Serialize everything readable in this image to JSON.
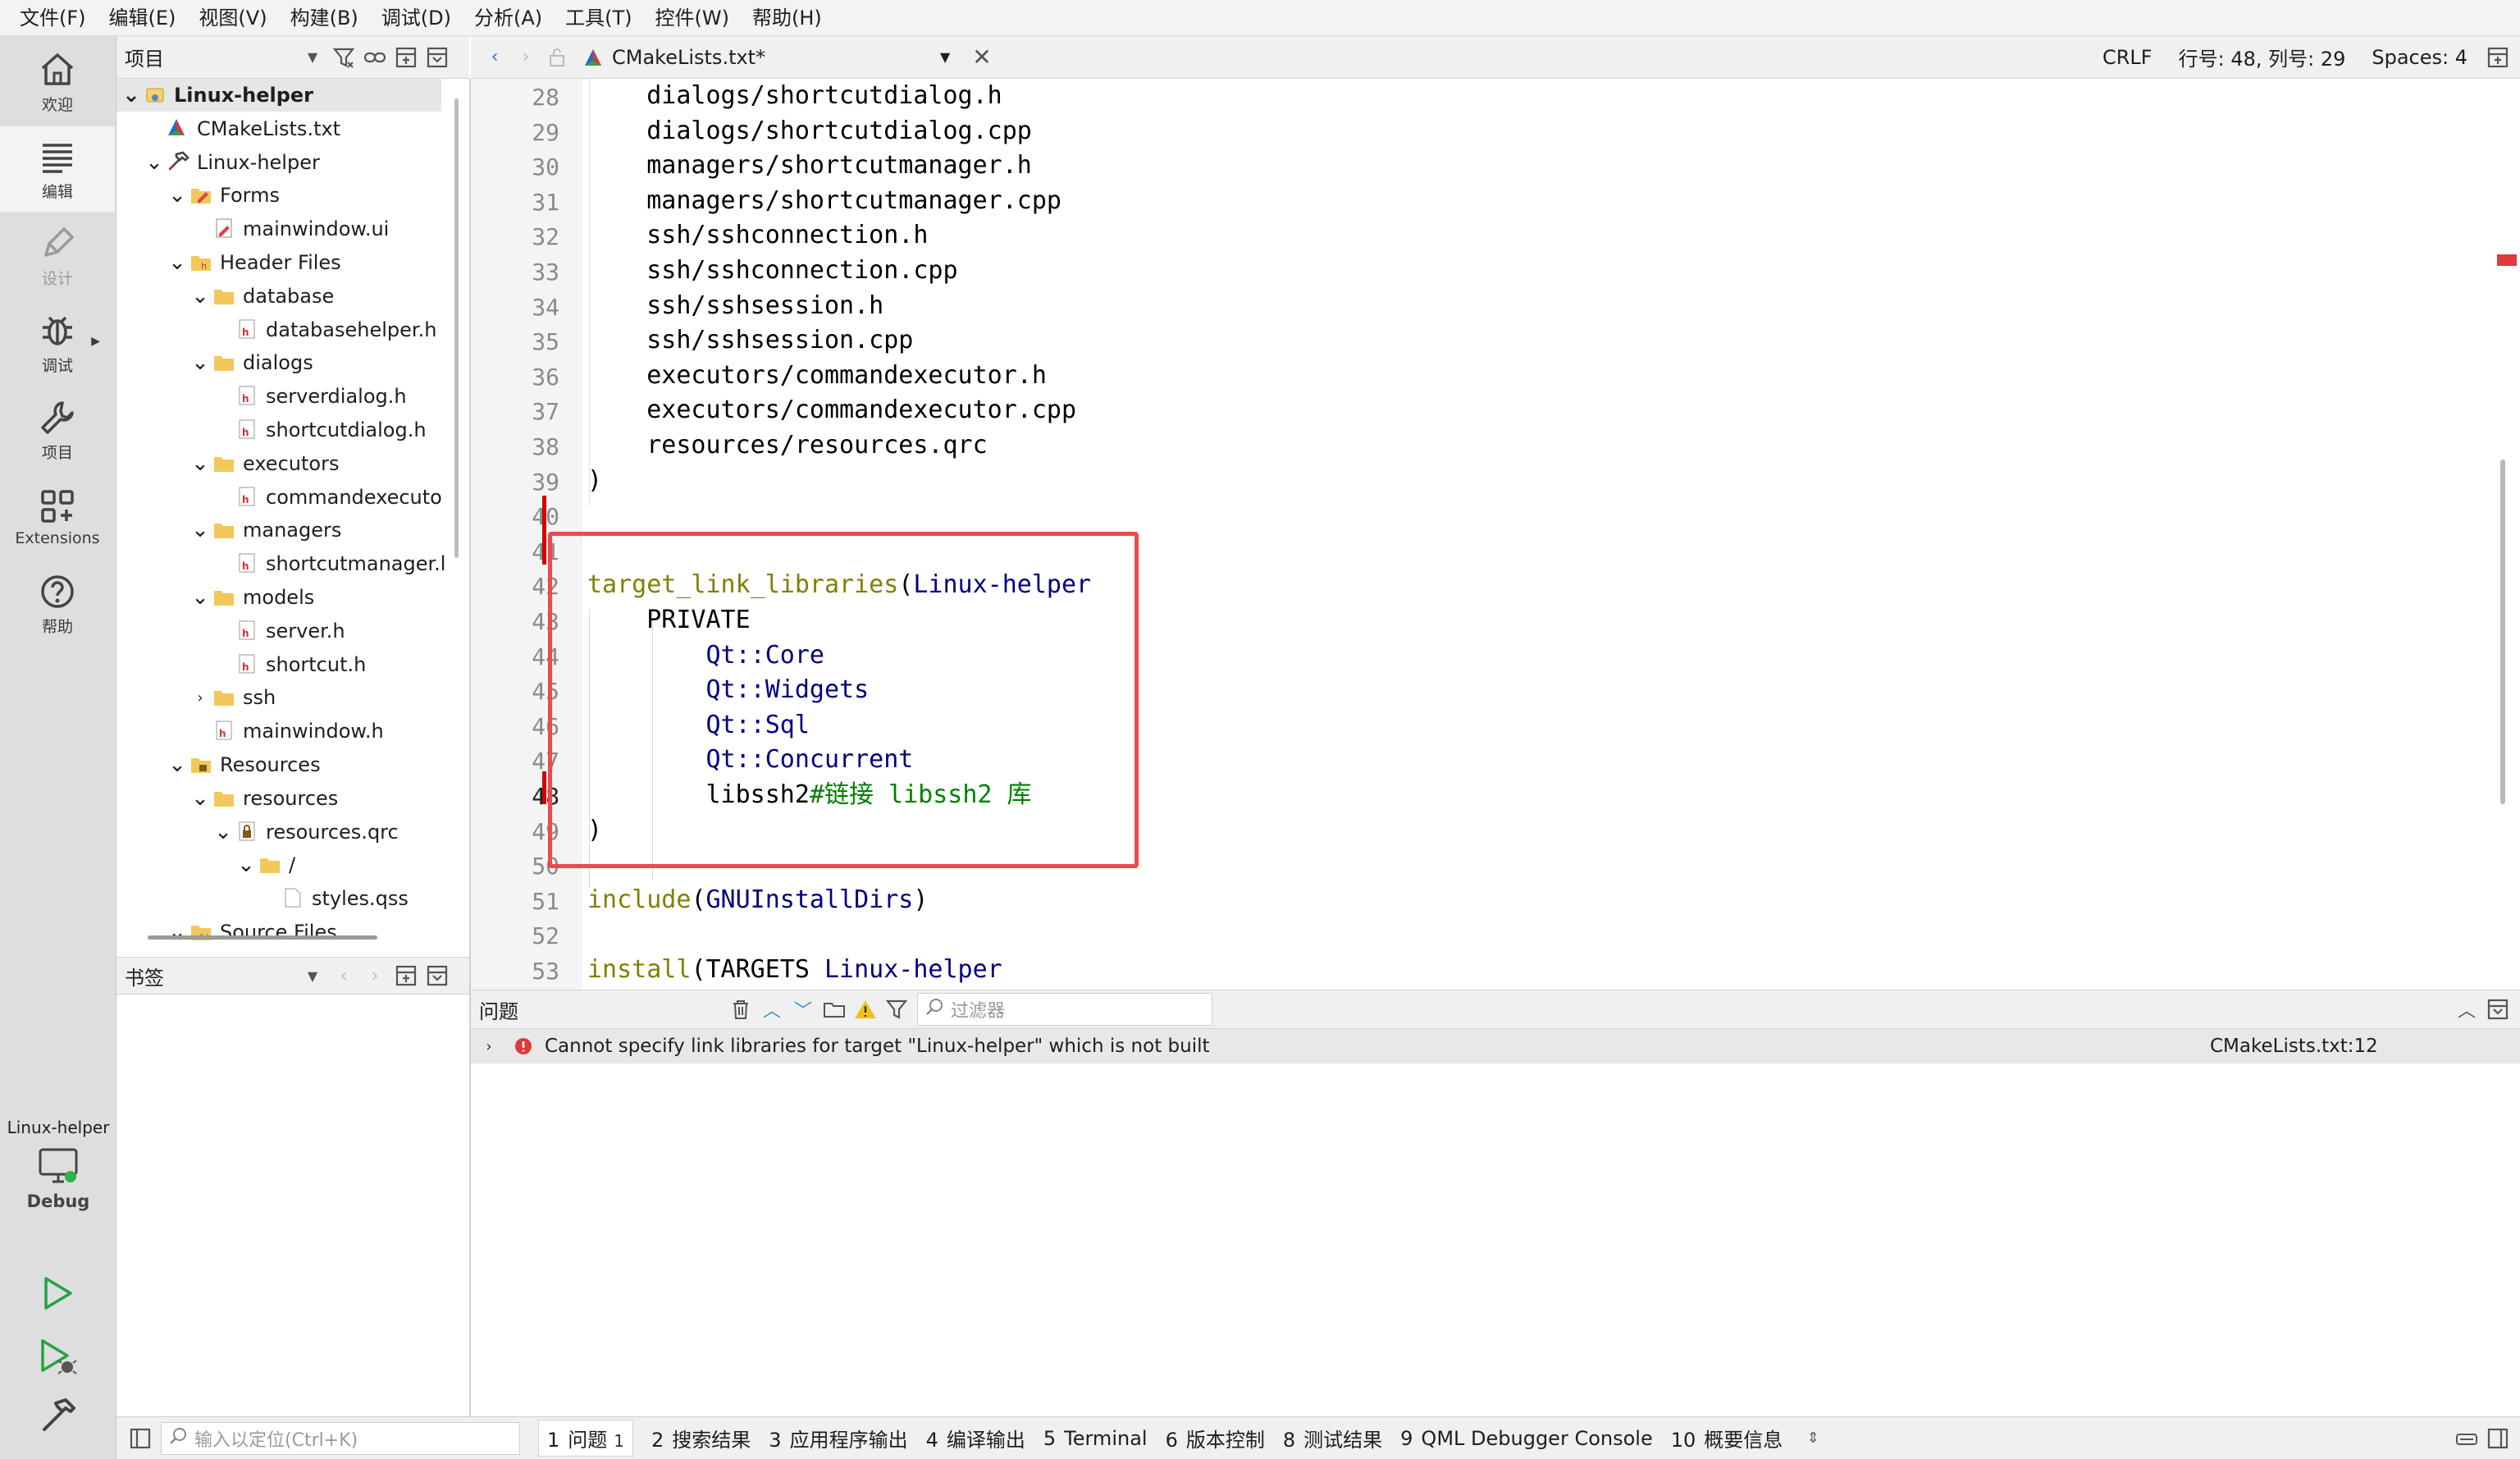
{
  "menu": [
    "文件(F)",
    "编辑(E)",
    "视图(V)",
    "构建(B)",
    "调试(D)",
    "分析(A)",
    "工具(T)",
    "控件(W)",
    "帮助(H)"
  ],
  "modes": [
    {
      "label": "欢迎",
      "icon": "home-icon",
      "active": false,
      "disabled": false
    },
    {
      "label": "编辑",
      "icon": "edit-lines-icon",
      "active": true,
      "disabled": false
    },
    {
      "label": "设计",
      "icon": "pen-icon",
      "active": false,
      "disabled": true
    },
    {
      "label": "调试",
      "icon": "bug-icon",
      "active": false,
      "disabled": false
    },
    {
      "label": "项目",
      "icon": "wrench-icon",
      "active": false,
      "disabled": false
    },
    {
      "label": "Extensions",
      "icon": "extensions-icon",
      "active": false,
      "disabled": false
    },
    {
      "label": "帮助",
      "icon": "help-icon",
      "active": false,
      "disabled": false
    }
  ],
  "kit": {
    "project": "Linux-helper",
    "build": "Debug"
  },
  "project_panel": {
    "title": "项目"
  },
  "tree": [
    {
      "d": 0,
      "a": "v",
      "i": "project",
      "t": "Linux-helper",
      "sel": true
    },
    {
      "d": 1,
      "a": "",
      "i": "cmake",
      "t": "CMakeLists.txt"
    },
    {
      "d": 1,
      "a": "v",
      "i": "hammer",
      "t": "Linux-helper"
    },
    {
      "d": 2,
      "a": "v",
      "i": "forms",
      "t": "Forms"
    },
    {
      "d": 3,
      "a": "",
      "i": "ui",
      "t": "mainwindow.ui"
    },
    {
      "d": 2,
      "a": "v",
      "i": "hfolder",
      "t": "Header Files"
    },
    {
      "d": 3,
      "a": "v",
      "i": "folder",
      "t": "database"
    },
    {
      "d": 4,
      "a": "",
      "i": "h",
      "t": "databasehelper.h"
    },
    {
      "d": 3,
      "a": "v",
      "i": "folder",
      "t": "dialogs"
    },
    {
      "d": 4,
      "a": "",
      "i": "h",
      "t": "serverdialog.h"
    },
    {
      "d": 4,
      "a": "",
      "i": "h",
      "t": "shortcutdialog.h"
    },
    {
      "d": 3,
      "a": "v",
      "i": "folder",
      "t": "executors"
    },
    {
      "d": 4,
      "a": "",
      "i": "h",
      "t": "commandexecuto"
    },
    {
      "d": 3,
      "a": "v",
      "i": "folder",
      "t": "managers"
    },
    {
      "d": 4,
      "a": "",
      "i": "h",
      "t": "shortcutmanager.l"
    },
    {
      "d": 3,
      "a": "v",
      "i": "folder",
      "t": "models"
    },
    {
      "d": 4,
      "a": "",
      "i": "h",
      "t": "server.h"
    },
    {
      "d": 4,
      "a": "",
      "i": "h",
      "t": "shortcut.h"
    },
    {
      "d": 3,
      "a": ">",
      "i": "folder",
      "t": "ssh"
    },
    {
      "d": 3,
      "a": "",
      "i": "h",
      "t": "mainwindow.h"
    },
    {
      "d": 2,
      "a": "v",
      "i": "rfolder",
      "t": "Resources"
    },
    {
      "d": 3,
      "a": "v",
      "i": "folder",
      "t": "resources"
    },
    {
      "d": 4,
      "a": "v",
      "i": "qrc",
      "t": "resources.qrc"
    },
    {
      "d": 5,
      "a": "v",
      "i": "folder",
      "t": "/"
    },
    {
      "d": 6,
      "a": "",
      "i": "file",
      "t": "styles.qss"
    },
    {
      "d": 2,
      "a": "v",
      "i": "sfolder",
      "t": "Source Files"
    }
  ],
  "bookmarks": {
    "title": "书签"
  },
  "editor": {
    "file": "CMakeLists.txt*",
    "line_ending": "CRLF",
    "position": "行号: 48, 列号: 29",
    "indent": "Spaces: 4"
  },
  "code": [
    {
      "n": "28",
      "segs": [
        {
          "c": "plain",
          "t": "    dialogs/shortcutdialog.h"
        }
      ]
    },
    {
      "n": "29",
      "segs": [
        {
          "c": "plain",
          "t": "    dialogs/shortcutdialog.cpp"
        }
      ]
    },
    {
      "n": "30",
      "segs": [
        {
          "c": "plain",
          "t": "    managers/shortcutmanager.h"
        }
      ]
    },
    {
      "n": "31",
      "segs": [
        {
          "c": "plain",
          "t": "    managers/shortcutmanager.cpp"
        }
      ]
    },
    {
      "n": "32",
      "segs": [
        {
          "c": "plain",
          "t": "    ssh/sshconnection.h"
        }
      ]
    },
    {
      "n": "33",
      "segs": [
        {
          "c": "plain",
          "t": "    ssh/sshconnection.cpp"
        }
      ]
    },
    {
      "n": "34",
      "segs": [
        {
          "c": "plain",
          "t": "    ssh/sshsession.h"
        }
      ]
    },
    {
      "n": "35",
      "segs": [
        {
          "c": "plain",
          "t": "    ssh/sshsession.cpp"
        }
      ]
    },
    {
      "n": "36",
      "segs": [
        {
          "c": "plain",
          "t": "    executors/commandexecutor.h"
        }
      ]
    },
    {
      "n": "37",
      "segs": [
        {
          "c": "plain",
          "t": "    executors/commandexecutor.cpp"
        }
      ]
    },
    {
      "n": "38",
      "segs": [
        {
          "c": "plain",
          "t": "    resources/resources.qrc"
        }
      ]
    },
    {
      "n": "39",
      "segs": [
        {
          "c": "plain",
          "t": ")"
        }
      ]
    },
    {
      "n": "40",
      "segs": []
    },
    {
      "n": "41",
      "segs": []
    },
    {
      "n": "42",
      "segs": [
        {
          "c": "kw",
          "t": "target_link_libraries"
        },
        {
          "c": "plain",
          "t": "("
        },
        {
          "c": "qt",
          "t": "Linux-helper"
        }
      ]
    },
    {
      "n": "43",
      "segs": [
        {
          "c": "plain",
          "t": "    PRIVATE"
        }
      ]
    },
    {
      "n": "44",
      "segs": [
        {
          "c": "plain",
          "t": "        "
        },
        {
          "c": "qt",
          "t": "Qt::Core"
        }
      ]
    },
    {
      "n": "45",
      "segs": [
        {
          "c": "plain",
          "t": "        "
        },
        {
          "c": "qt",
          "t": "Qt::Widgets"
        }
      ]
    },
    {
      "n": "46",
      "segs": [
        {
          "c": "plain",
          "t": "        "
        },
        {
          "c": "qt",
          "t": "Qt::Sql"
        }
      ]
    },
    {
      "n": "47",
      "segs": [
        {
          "c": "plain",
          "t": "        "
        },
        {
          "c": "qt",
          "t": "Qt::Concurrent"
        }
      ]
    },
    {
      "n": "48",
      "segs": [
        {
          "c": "plain",
          "t": "        libssh2"
        },
        {
          "c": "cm",
          "t": "#链接 libssh2 库"
        }
      ],
      "cur": true
    },
    {
      "n": "49",
      "segs": [
        {
          "c": "plain",
          "t": ")"
        }
      ]
    },
    {
      "n": "50",
      "segs": []
    },
    {
      "n": "51",
      "segs": [
        {
          "c": "kw",
          "t": "include"
        },
        {
          "c": "plain",
          "t": "("
        },
        {
          "c": "qt",
          "t": "GNUInstallDirs"
        },
        {
          "c": "plain",
          "t": ")"
        }
      ]
    },
    {
      "n": "52",
      "segs": []
    },
    {
      "n": "53",
      "segs": [
        {
          "c": "kw",
          "t": "install"
        },
        {
          "c": "plain",
          "t": "(TARGETS "
        },
        {
          "c": "qt",
          "t": "Linux-helper"
        }
      ]
    }
  ],
  "issues": {
    "title": "问题",
    "filter_placeholder": "过滤器",
    "rows": [
      {
        "text": "Cannot specify link libraries for target \"Linux-helper\" which is not built",
        "location": "CMakeLists.txt:12"
      }
    ]
  },
  "statusbar": {
    "locator_placeholder": "输入以定位(Ctrl+K)",
    "tabs": [
      {
        "n": "1",
        "label": "问题",
        "badge": "1",
        "active": true
      },
      {
        "n": "2",
        "label": "搜索结果"
      },
      {
        "n": "3",
        "label": "应用程序输出"
      },
      {
        "n": "4",
        "label": "编译输出"
      },
      {
        "n": "5",
        "label": "Terminal"
      },
      {
        "n": "6",
        "label": "版本控制"
      },
      {
        "n": "8",
        "label": "测试结果"
      },
      {
        "n": "9",
        "label": "QML Debugger Console"
      },
      {
        "n": "10",
        "label": "概要信息"
      }
    ]
  }
}
